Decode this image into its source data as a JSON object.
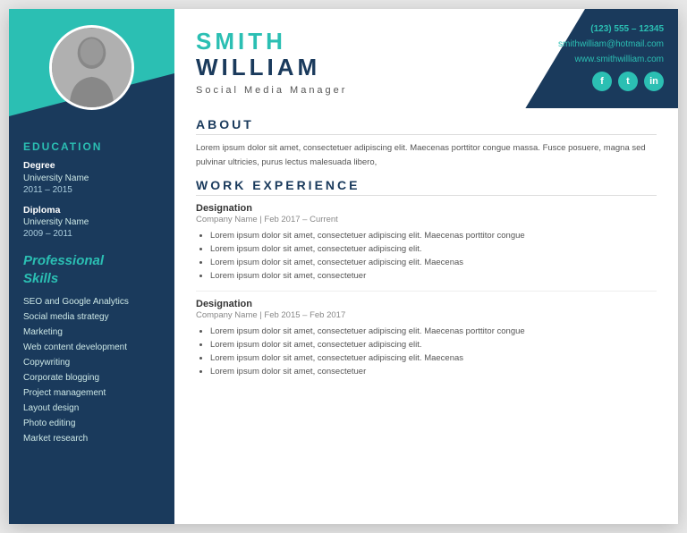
{
  "sidebar": {
    "education_title": "EDUCATION",
    "education_items": [
      {
        "degree": "Degree",
        "university": "University Name",
        "years": "2011 – 2015"
      },
      {
        "degree": "Diploma",
        "university": "University Name",
        "years": "2009 – 2011"
      }
    ],
    "skills_title": "Professional\nSkills",
    "skills": [
      "SEO and Google Analytics",
      "Social media strategy",
      "Marketing",
      "Web content development",
      "Copywriting",
      "Corporate blogging",
      "Project management",
      "Layout design",
      "Photo editing",
      "Market research"
    ]
  },
  "header": {
    "first_name": "SMITH",
    "last_name": "WILLIAM",
    "job_title": "Social  Media  Manager",
    "phone": "(123) 555 – 12345",
    "email": "smithwilliam@hotmail.com",
    "website": "www.smithwilliam.com"
  },
  "about": {
    "title": "ABOUT",
    "text": "Lorem ipsum dolor sit amet, consectetuer adipiscing elit. Maecenas porttitor congue massa. Fusce posuere, magna sed pulvinar ultricies, purus lectus malesuada libero,"
  },
  "work_experience": {
    "title": "WORK EXPERIENCE",
    "jobs": [
      {
        "designation": "Designation",
        "company": "Company Name",
        "date_range": "Feb 2017 – Current",
        "bullets": [
          "Lorem ipsum dolor sit amet, consectetuer adipiscing elit. Maecenas porttitor congue",
          "Lorem ipsum dolor sit amet, consectetuer adipiscing elit.",
          "Lorem ipsum dolor sit amet, consectetuer adipiscing elit. Maecenas",
          "Lorem ipsum dolor sit amet, consectetuer"
        ]
      },
      {
        "designation": "Designation",
        "company": "Company Name",
        "date_range": "Feb 2015 – Feb 2017",
        "bullets": [
          "Lorem ipsum dolor sit amet, consectetuer adipiscing elit. Maecenas porttitor congue",
          "Lorem ipsum dolor sit amet, consectetuer adipiscing elit.",
          "Lorem ipsum dolor sit amet, consectetuer adipiscing elit. Maecenas",
          "Lorem ipsum dolor sit amet, consectetuer"
        ]
      }
    ]
  },
  "colors": {
    "teal": "#2bbfb3",
    "navy": "#1a3a5c"
  }
}
